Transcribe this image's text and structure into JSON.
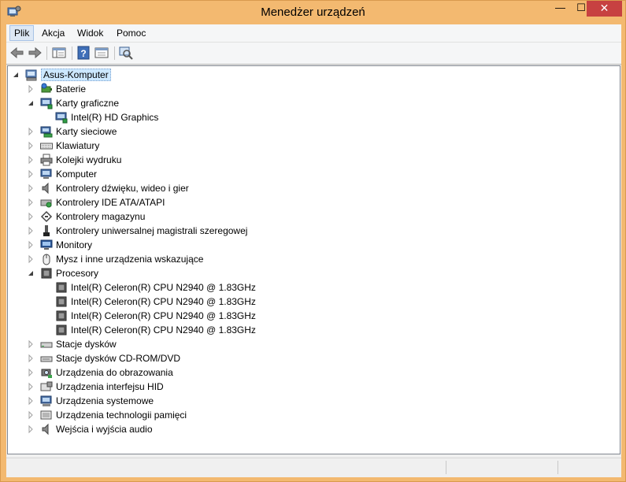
{
  "window": {
    "title": "Menedżer urządzeń",
    "controls": {
      "minimize": "—",
      "maximize": "☐",
      "close": "✕"
    }
  },
  "menu": {
    "items": [
      "Plik",
      "Akcja",
      "Widok",
      "Pomoc"
    ],
    "active": "Plik"
  },
  "toolbar": {
    "buttons": [
      "back-arrow-icon",
      "forward-arrow-icon",
      "show-hide-tree-icon",
      "help-icon",
      "properties-icon",
      "scan-hardware-icon"
    ]
  },
  "tree": {
    "root": "Asus-Komputer",
    "nodes": [
      {
        "label": "Baterie",
        "icon": "battery-icon",
        "expanded": false
      },
      {
        "label": "Karty graficzne",
        "icon": "display-adapter-icon",
        "expanded": true,
        "children": [
          "Intel(R) HD Graphics"
        ]
      },
      {
        "label": "Karty sieciowe",
        "icon": "network-adapter-icon",
        "expanded": false
      },
      {
        "label": "Klawiatury",
        "icon": "keyboard-icon",
        "expanded": false
      },
      {
        "label": "Kolejki wydruku",
        "icon": "printer-icon",
        "expanded": false
      },
      {
        "label": "Komputer",
        "icon": "computer-icon",
        "expanded": false
      },
      {
        "label": "Kontrolery dźwięku, wideo i gier",
        "icon": "speaker-icon",
        "expanded": false
      },
      {
        "label": "Kontrolery IDE ATA/ATAPI",
        "icon": "ide-controller-icon",
        "expanded": false
      },
      {
        "label": "Kontrolery magazynu",
        "icon": "storage-controller-icon",
        "expanded": false
      },
      {
        "label": "Kontrolery uniwersalnej magistrali szeregowej",
        "icon": "usb-icon",
        "expanded": false
      },
      {
        "label": "Monitory",
        "icon": "monitor-icon",
        "expanded": false
      },
      {
        "label": "Mysz i inne urządzenia wskazujące",
        "icon": "mouse-icon",
        "expanded": false
      },
      {
        "label": "Procesory",
        "icon": "processor-icon",
        "expanded": true,
        "children": [
          "Intel(R) Celeron(R) CPU  N2940  @ 1.83GHz",
          "Intel(R) Celeron(R) CPU  N2940  @ 1.83GHz",
          "Intel(R) Celeron(R) CPU  N2940  @ 1.83GHz",
          "Intel(R) Celeron(R) CPU  N2940  @ 1.83GHz"
        ]
      },
      {
        "label": "Stacje dysków",
        "icon": "disk-drive-icon",
        "expanded": false
      },
      {
        "label": "Stacje dysków CD-ROM/DVD",
        "icon": "cdrom-icon",
        "expanded": false
      },
      {
        "label": "Urządzenia do obrazowania",
        "icon": "imaging-device-icon",
        "expanded": false
      },
      {
        "label": "Urządzenia interfejsu HID",
        "icon": "hid-icon",
        "expanded": false
      },
      {
        "label": "Urządzenia systemowe",
        "icon": "system-device-icon",
        "expanded": false
      },
      {
        "label": "Urządzenia technologii pamięci",
        "icon": "memory-tech-icon",
        "expanded": false
      },
      {
        "label": "Wejścia i wyjścia audio",
        "icon": "audio-io-icon",
        "expanded": false
      }
    ]
  },
  "colors": {
    "frame": "#f3b970",
    "close": "#c74141",
    "selection": "#cce8ff"
  }
}
